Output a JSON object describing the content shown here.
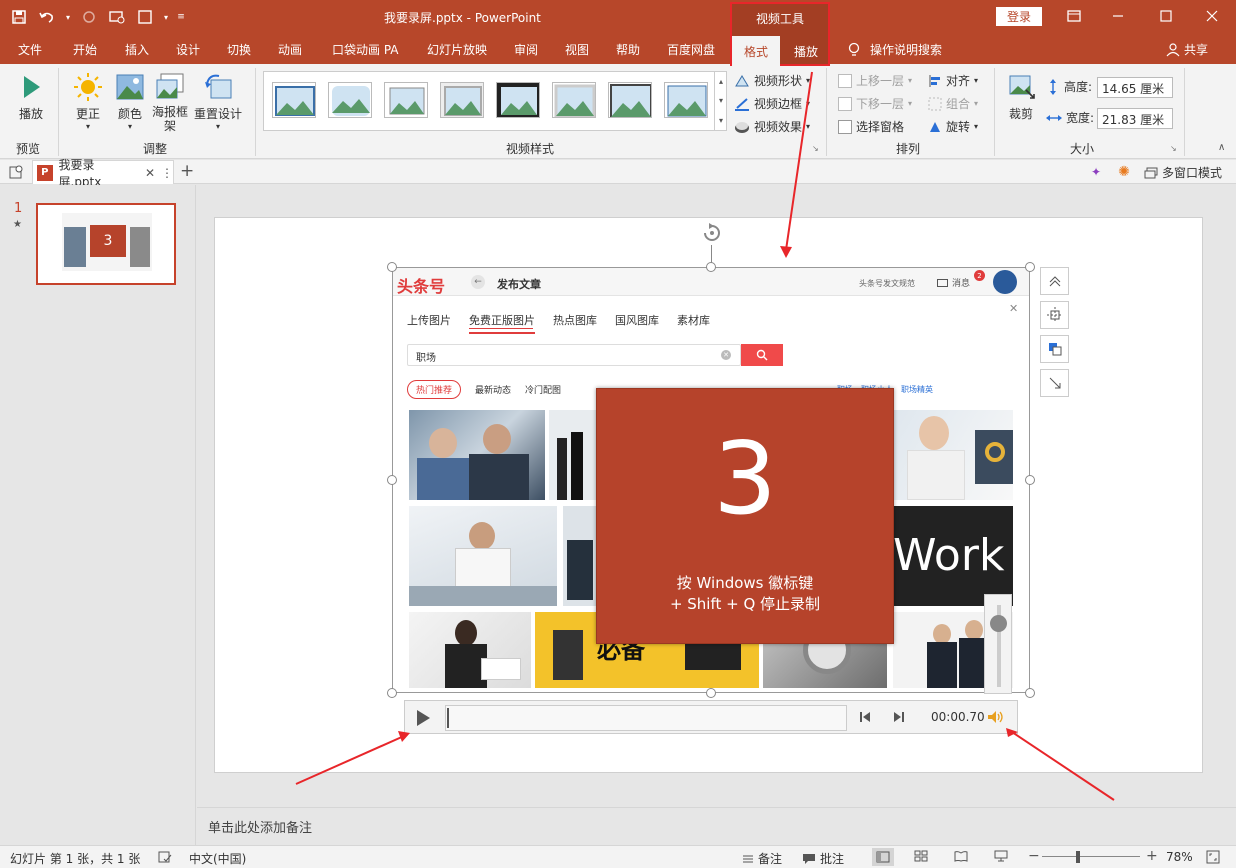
{
  "window": {
    "doc_title": "我要录屏.pptx  -  PowerPoint",
    "login_label": "登录",
    "context_group": "视频工具",
    "context_tabs": [
      "格式",
      "播放"
    ]
  },
  "tabs": [
    "文件",
    "开始",
    "插入",
    "设计",
    "切换",
    "动画",
    "口袋动画 PA",
    "幻灯片放映",
    "审阅",
    "视图",
    "帮助",
    "百度网盘"
  ],
  "tell_me": "操作说明搜索",
  "share_label": "共享",
  "ribbon": {
    "preview": {
      "play": "播放",
      "group": "预览"
    },
    "adjust": {
      "correct": "更正",
      "color": "颜色",
      "poster_1": "海报框",
      "poster_2": "架",
      "reset": "重置设计",
      "group": "调整"
    },
    "video_styles": {
      "group": "视频样式",
      "shape": "视频形状",
      "border": "视频边框",
      "effects": "视频效果"
    },
    "arrange": {
      "group": "排列",
      "bring_forward": "上移一层",
      "send_backward": "下移一层",
      "selection_pane": "选择窗格",
      "align": "对齐",
      "group_btn": "组合",
      "rotate": "旋转"
    },
    "size": {
      "group": "大小",
      "crop": "裁剪",
      "height_label": "高度:",
      "height": "14.65 厘米",
      "width_label": "宽度:",
      "width": "21.83 厘米"
    }
  },
  "doc_tab": {
    "name": "我要录屏.pptx",
    "multi_window": "多窗口模式"
  },
  "slides": {
    "number": "1",
    "star": "★",
    "thumb_number": "3"
  },
  "video": {
    "logo": "头条号",
    "publish": "发布文章",
    "top_right": "头条号发文规范",
    "messages": "消息",
    "badge": "2",
    "tabs": [
      "上传图片",
      "免费正版图片",
      "热点图库",
      "国风图库",
      "素材库"
    ],
    "search_value": "职场",
    "filters": [
      "热门推荐",
      "最新动态",
      "冷门配图"
    ],
    "right_links": [
      "职场",
      "职场小人",
      "职场精英"
    ],
    "work_text": "Work",
    "sign_text": "必备"
  },
  "countdown": {
    "number": "3",
    "line1": "按 Windows 徽标键",
    "line2": "+ Shift + Q 停止录制"
  },
  "player": {
    "time": "00:00.70"
  },
  "notes_placeholder": "单击此处添加备注",
  "status": {
    "slide_info": "幻灯片 第 1 张，共 1 张",
    "language": "中文(中国)",
    "notes": "备注",
    "comments": "批注",
    "zoom": "78%"
  },
  "colors": {
    "accent": "#b7472a",
    "highlight": "#e8262a",
    "countdown_bg": "#b6432b"
  }
}
